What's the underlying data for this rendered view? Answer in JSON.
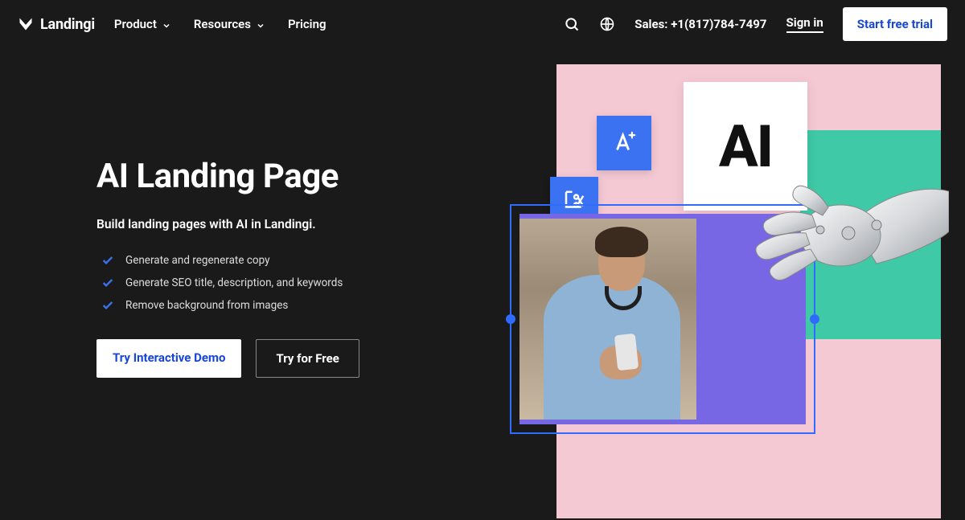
{
  "brand": "Landingi",
  "nav": {
    "product": "Product",
    "resources": "Resources",
    "pricing": "Pricing"
  },
  "header": {
    "sales": "Sales: +1(817)784-7497",
    "sign_in": "Sign in",
    "cta": "Start free trial"
  },
  "hero": {
    "title": "AI Landing Page",
    "subtitle": "Build landing pages with AI in Landingi.",
    "features": [
      "Generate and regenerate copy",
      "Generate SEO title, description, and keywords",
      "Remove background from images"
    ],
    "btn_demo": "Try Interactive Demo",
    "btn_free": "Try for Free"
  },
  "collage": {
    "ai_label": "AI"
  }
}
